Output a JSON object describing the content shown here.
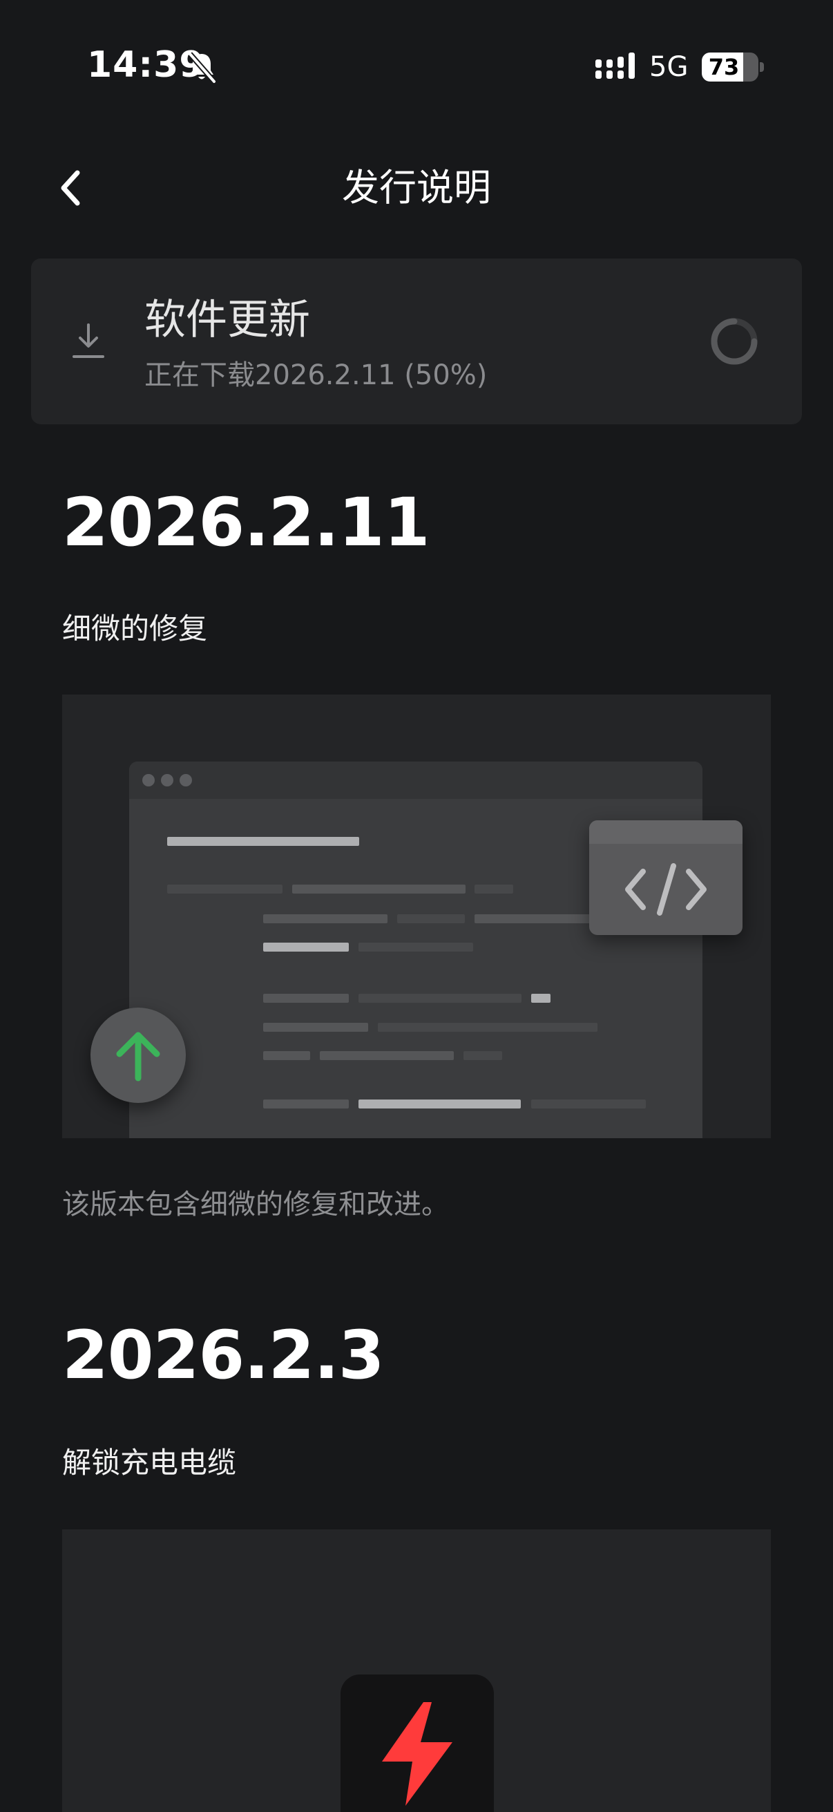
{
  "status_bar": {
    "time": "14:39",
    "mute_icon": "bell-slash-icon",
    "signal_icon": "cellular-signal-icon",
    "network": "5G",
    "battery_percent": 73
  },
  "battery_label": "73",
  "header": {
    "back_icon": "chevron-left-icon",
    "title": "发行说明"
  },
  "update_card": {
    "icon": "download-icon",
    "title": "软件更新",
    "status": "正在下载2026.2.11 (50%)",
    "progress": 0.5,
    "spinner_icon": "loading-spinner-icon"
  },
  "releases": [
    {
      "version": "2026.2.11",
      "subtitle": "细微的修复",
      "illustration_icons": [
        "code-icon",
        "upload-arrow-icon"
      ],
      "description": "该版本包含细微的修复和改进。"
    },
    {
      "version": "2026.2.3",
      "subtitle": "解锁充电电缆",
      "illustration_icons": [
        "lightning-bolt-icon"
      ]
    }
  ],
  "colors": {
    "background": "#17181a",
    "card": "#232426",
    "upload_green": "#3cb45a",
    "bolt_red": "#ff3b3b"
  }
}
